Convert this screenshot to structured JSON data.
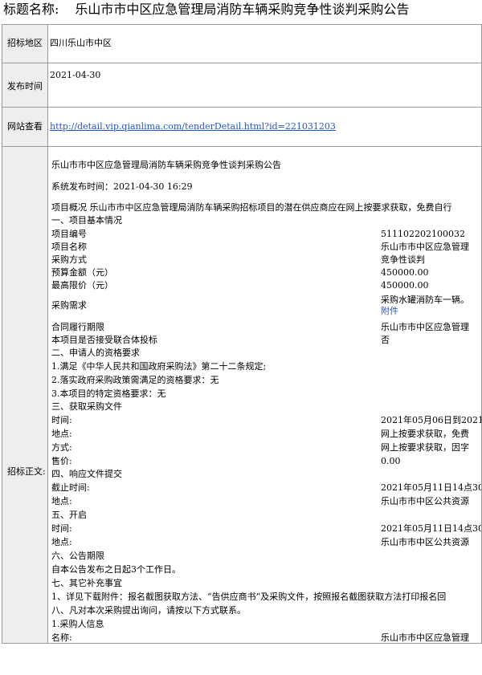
{
  "header": {
    "label": "标题名称:",
    "title": "乐山市市中区应急管理局消防车辆采购竞争性谈判采购公告"
  },
  "rows": {
    "region": {
      "key": "招标地区",
      "value": "四川乐山市中区"
    },
    "date": {
      "key": "发布时间",
      "value": "2021-04-30"
    },
    "url": {
      "key": "网站查看",
      "value": "http://detail.vip.qianlima.com/tenderDetail.html?id=221031203"
    },
    "body": {
      "key": "招标正文:"
    }
  },
  "doc": {
    "title": "乐山市市中区应急管理局消防车辆采购竞争性谈判采购公告",
    "sys_time": "系统发布时间：2021-04-30 16:29",
    "overview": "项目概况 乐山市市中区应急管理局消防车辆采购招标项目的潜在供应商应在网上按要求获取，免费自行",
    "s1": "一、项目基本情况",
    "p1k": "项目编号",
    "p1v": "511102202100032",
    "p2k": "项目名称",
    "p2v": "乐山市市中区应急管理",
    "p3k": "采购方式",
    "p3v": "竞争性谈判",
    "p4k": "预算金额（元）",
    "p4v": "450000.00",
    "p5k": "最高限价（元）",
    "p5v": "450000.00",
    "p6k": "采购需求",
    "p6v": "采购水罐消防车一辆。",
    "p6a": "附件",
    "p7k": "合同履行期限",
    "p7v": "乐山市市中区应急管理",
    "p8k": "本项目是否接受联合体投标",
    "p8v": "否",
    "s2": "二、申请人的资格要求",
    "q1": "1.满足《中华人民共和国政府采购法》第二十二条规定;",
    "q2": "2.落实政府采购政策需满足的资格要求：无",
    "q3": "3.本项目的特定资格要求：无",
    "s3": "三、获取采购文件",
    "g1k": "时间:",
    "g1v": "2021年05月06日到2021",
    "g2k": "地点:",
    "g2v": "网上按要求获取，免费",
    "g3k": "方式:",
    "g3v": "网上按要求获取，因字",
    "g4k": "售价:",
    "g4v": "0.00",
    "s4": "四、响应文件提交",
    "h1k": "截止时间:",
    "h1v": "2021年05月11日14点30",
    "h2k": "地点:",
    "h2v": "乐山市市中区公共资源",
    "s5": "五、开启",
    "o1k": "时间:",
    "o1v": "2021年05月11日14点30",
    "o2k": "地点:",
    "o2v": "乐山市市中区公共资源",
    "s6": "六、公告期限",
    "t1": "自本公告发布之日起3个工作日。",
    "s7": "七、其它补充事宜",
    "e1": "1、详见下载附件：报名截图获取方法、“告供应商书”及采购文件，按照报名截图获取方法打印报名回",
    "s8": "八、凡对本次采购提出询问，请按以下方式联系。",
    "c1": "1.采购人信息",
    "c2k": "名称:",
    "c2v": "乐山市市中区应急管理"
  }
}
